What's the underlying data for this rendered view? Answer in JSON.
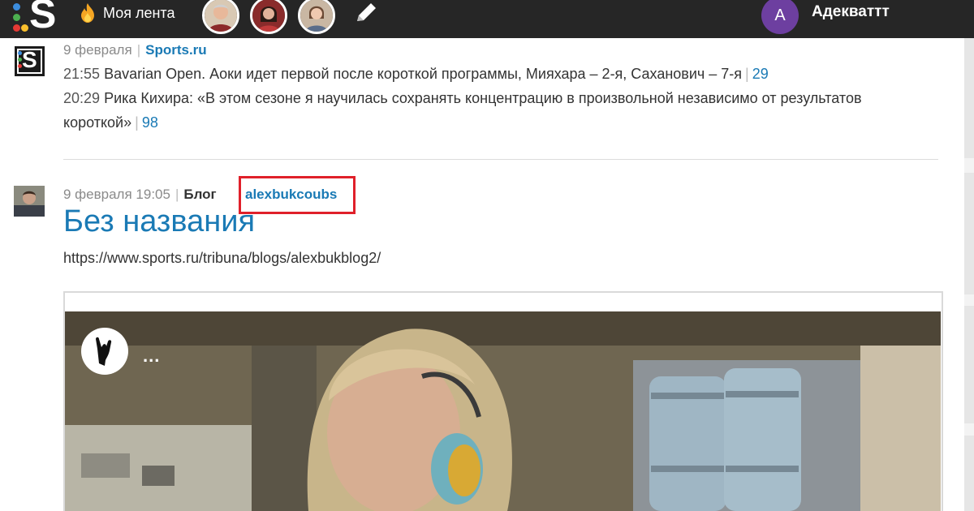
{
  "header": {
    "logo_letter": "S",
    "feed_label": "Моя лента",
    "user_initial": "А",
    "user_name": "Адекваттт"
  },
  "entries": [
    {
      "date": "9 февраля",
      "source": "Sports.ru",
      "items": [
        {
          "time": "21:55",
          "text": "Bavarian Open. Аоки идет первой после короткой программы, Мияхара – 2-я, Саханович – 7-я",
          "comments": "29"
        },
        {
          "time": "20:29",
          "text": "Рика Кихира: «В этом сезоне я научилась сохранять концентрацию в произвольной независимо от результатов короткой»",
          "comments": "98"
        }
      ]
    }
  ],
  "post": {
    "datetime": "9 февраля 19:05",
    "blog_label": "Блог",
    "blog_name": "alexbukcoubs",
    "title": "Без названия",
    "url": "https://www.sports.ru/tribuna/blogs/alexbukblog2/",
    "video_more": "..."
  },
  "colors": {
    "topbar": "#262626",
    "link": "#1a7ab5",
    "highlight": "#e0202a",
    "user_badge": "#6d3fa0"
  }
}
